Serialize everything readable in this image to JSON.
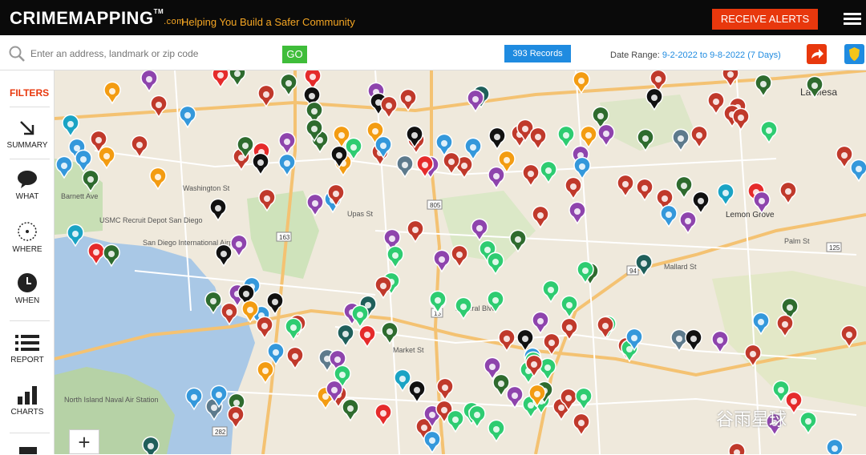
{
  "header": {
    "logo_text": "CRIMEMAPPING",
    "logo_tm": "TM",
    "logo_com": ".com",
    "tagline": "Helping You Build a Safer Community",
    "alerts_button": "RECEIVE ALERTS",
    "menu_icon": "hamburger-menu-icon"
  },
  "search": {
    "placeholder": "Enter an address, landmark or zip code",
    "go_button": "GO",
    "records": "393 Records",
    "date_range_label": "Date Range:",
    "date_range_value": "9-2-2022 to 9-8-2022 (7 Days)"
  },
  "sidebar": {
    "filters": "FILTERS",
    "items": [
      {
        "label": "SUMMARY",
        "icon": "arrow-down-right-icon"
      },
      {
        "label": "WHAT",
        "icon": "speech-bubble-icon"
      },
      {
        "label": "WHERE",
        "icon": "dotted-circle-icon"
      },
      {
        "label": "WHEN",
        "icon": "clock-icon"
      },
      {
        "label": "REPORT",
        "icon": "list-icon"
      },
      {
        "label": "CHARTS",
        "icon": "bar-chart-icon"
      }
    ]
  },
  "map": {
    "place_labels": [
      "La Mesa",
      "Lemon Grove",
      "USMC Recruit Depot San Diego",
      "San Diego International Airport",
      "North Island Naval Air Station",
      "Barnett Ave",
      "Washington St",
      "Upas St",
      "Market St",
      "Federal Blvd",
      "Mallard St",
      "Palm St"
    ],
    "road_numbers": [
      "163",
      "805",
      "94",
      "125",
      "15",
      "282"
    ],
    "zoom_in": "+"
  },
  "watermark": "谷雨星球",
  "colors": {
    "accent": "#e8380d",
    "blue": "#1f8be0",
    "green": "#3fbd3a",
    "orange": "#f5a623"
  }
}
